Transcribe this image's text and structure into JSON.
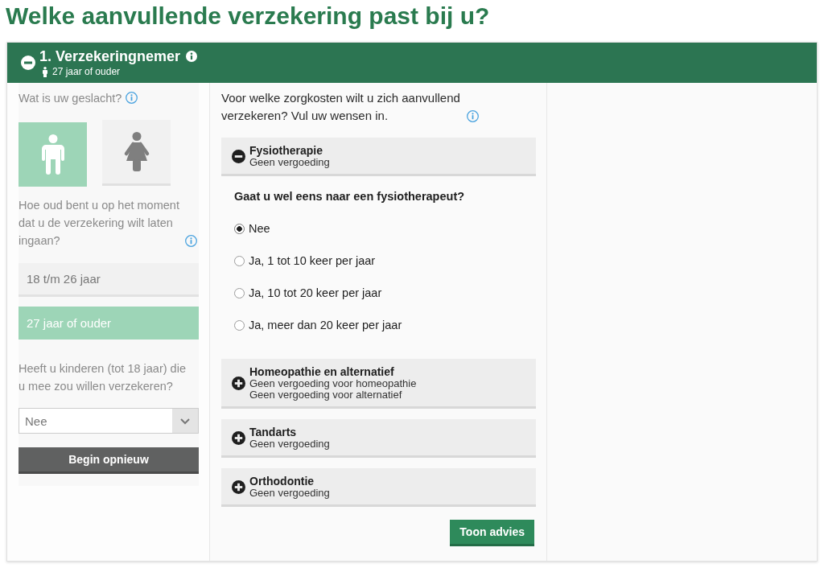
{
  "page": {
    "title": "Welke aanvullende verzekering past bij u?"
  },
  "panel": {
    "title": "1. Verzekeringnemer",
    "subtitle": "27 jaar of ouder",
    "expanded": true
  },
  "profile": {
    "gender_question": "Wat is uw geslacht?",
    "genders": [
      {
        "kind": "male",
        "selected": true
      },
      {
        "kind": "female",
        "selected": false
      }
    ],
    "age_question": "Hoe oud bent u op het moment dat u de verzekering wilt laten ingaan?",
    "ages": [
      {
        "label": "18 t/m 26 jaar",
        "selected": false
      },
      {
        "label": "27 jaar of ouder",
        "selected": true
      }
    ],
    "children_question": "Heeft u kinderen (tot 18 jaar) die u mee zou willen verzekeren?",
    "children_select": {
      "value": "Nee"
    },
    "reset_button": "Begin opnieuw"
  },
  "coverage": {
    "intro": "Voor welke zorgkosten wilt u zich aanvullend verzekeren? Vul uw wensen in.",
    "categories": [
      {
        "title": "Fysiotherapie",
        "details": [
          "Geen vergoeding"
        ],
        "expanded": true,
        "question": "Gaat u wel eens naar een fysiotherapeut?",
        "options": [
          {
            "label": "Nee",
            "selected": true
          },
          {
            "label": "Ja, 1 tot 10 keer per jaar",
            "selected": false
          },
          {
            "label": "Ja, 10 tot 20 keer per jaar",
            "selected": false
          },
          {
            "label": "Ja, meer dan 20 keer per jaar",
            "selected": false
          }
        ]
      },
      {
        "title": "Homeopathie en alternatief",
        "details": [
          "Geen vergoeding voor homeopathie",
          "Geen vergoeding voor alternatief"
        ],
        "expanded": false
      },
      {
        "title": "Tandarts",
        "details": [
          "Geen vergoeding"
        ],
        "expanded": false
      },
      {
        "title": "Orthodontie",
        "details": [
          "Geen vergoeding"
        ],
        "expanded": false
      }
    ],
    "submit_button": "Toon advies"
  }
}
